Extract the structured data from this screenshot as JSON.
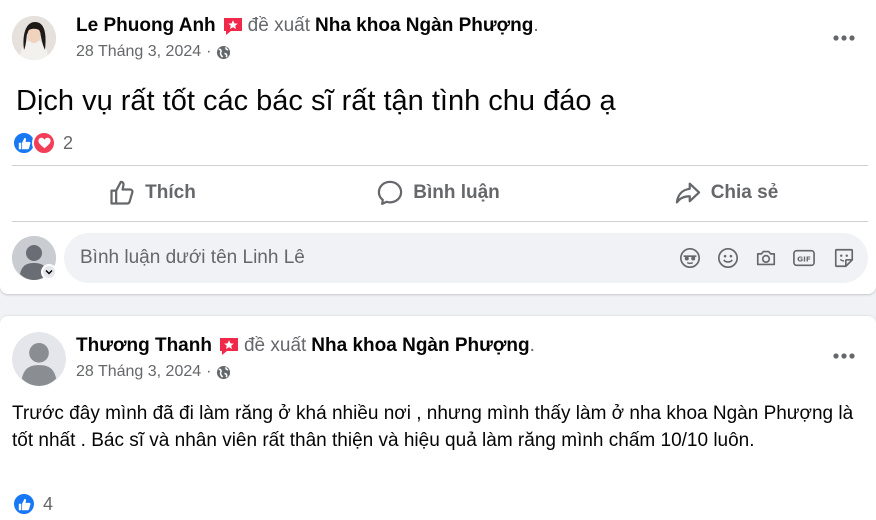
{
  "post1": {
    "author": "Le Phuong Anh",
    "verb": "đề xuất",
    "page": "Nha khoa Ngàn Phượng",
    "period": ".",
    "date": "28 Tháng 3, 2024",
    "separator": "·",
    "text": "Dịch vụ rất tốt các bác sĩ rất tận tình chu đáo ạ",
    "reactions": [
      "like-icon",
      "love-icon"
    ],
    "reaction_count": "2",
    "actions": {
      "like": "Thích",
      "comment": "Bình luận",
      "share": "Chia sẻ"
    },
    "comment_placeholder": "Bình luận dưới tên Linh Lê",
    "comment_icons": [
      "avatar-sticker-icon",
      "emoji-icon",
      "camera-icon",
      "gif-icon",
      "sticker-icon"
    ]
  },
  "post2": {
    "author": "Thương Thanh",
    "verb": "đề xuất",
    "page": "Nha khoa Ngàn Phượng",
    "period": ".",
    "date": "28 Tháng 3, 2024",
    "separator": "·",
    "text": "Trước đây mình đã đi làm răng ở khá nhiều nơi , nhưng mình thấy làm ở nha khoa Ngàn Phượng là tốt nhất . Bác sĩ và nhân viên rất thân thiện và hiệu quả làm răng mình chấm 10/10 luôn.",
    "reactions": [
      "like-icon"
    ],
    "reaction_count": "4"
  },
  "colors": {
    "like_blue": "#1877f2",
    "love_red": "#f33e58",
    "recommend_red": "#f02849",
    "secondary_text": "#65676b"
  }
}
